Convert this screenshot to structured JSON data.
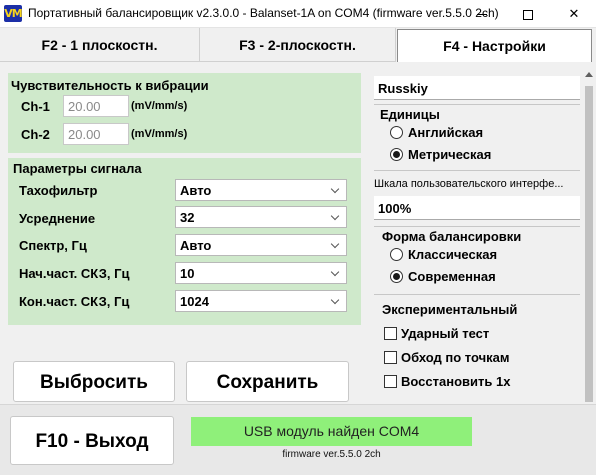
{
  "window": {
    "title": "Портативный балансировщик v2.3.0.0 - Balanset-1A on COM4 (firmware ver.5.5.0 2ch)",
    "icon_text": "VM"
  },
  "tabs": [
    {
      "label": "F2 - 1 плоскостн."
    },
    {
      "label": "F3 - 2-плоскостн."
    },
    {
      "label": "F4 - Настройки"
    }
  ],
  "vibration": {
    "title": "Чувствительность к вибрации",
    "ch1": {
      "label": "Ch-1",
      "value": "20.00",
      "unit": "(mV/mm/s)"
    },
    "ch2": {
      "label": "Ch-2",
      "value": "20.00",
      "unit": "(mV/mm/s)"
    }
  },
  "signal": {
    "title": "Параметры сигнала",
    "rows": [
      {
        "label": "Тахофильтр",
        "value": "Авто"
      },
      {
        "label": "Усреднение",
        "value": "32"
      },
      {
        "label": "Спектр, Гц",
        "value": "Авто"
      },
      {
        "label": "Нач.част. СКЗ, Гц",
        "value": "10"
      },
      {
        "label": "Кон.част. СКЗ, Гц",
        "value": "1024"
      }
    ]
  },
  "actions": {
    "reset": "Выбросить",
    "save": "Сохранить"
  },
  "settings": {
    "language": "Russkiy",
    "units": {
      "title": "Единицы",
      "options": [
        "Английская",
        "Метрическая"
      ],
      "selected": 1
    },
    "ui_scale": {
      "label": "Шкала пользовательского интерфе...",
      "value": "100%"
    },
    "balance_form": {
      "title": "Форма балансировки",
      "options": [
        "Классическая",
        "Современная"
      ],
      "selected": 1
    },
    "experimental": {
      "title": "Экспериментальный",
      "options": [
        "Ударный тест",
        "Обход по точкам",
        "Восстановить 1x"
      ]
    }
  },
  "footer": {
    "exit": "F10 - Выход",
    "status": "USB модуль найден COM4",
    "firmware": "firmware ver.5.5.0 2ch"
  },
  "colors": {
    "group_bg": "#cfe9cb",
    "status_bg": "#8ff07a",
    "icon_bg": "#1c2fa7",
    "icon_fg": "#f6d41c"
  }
}
